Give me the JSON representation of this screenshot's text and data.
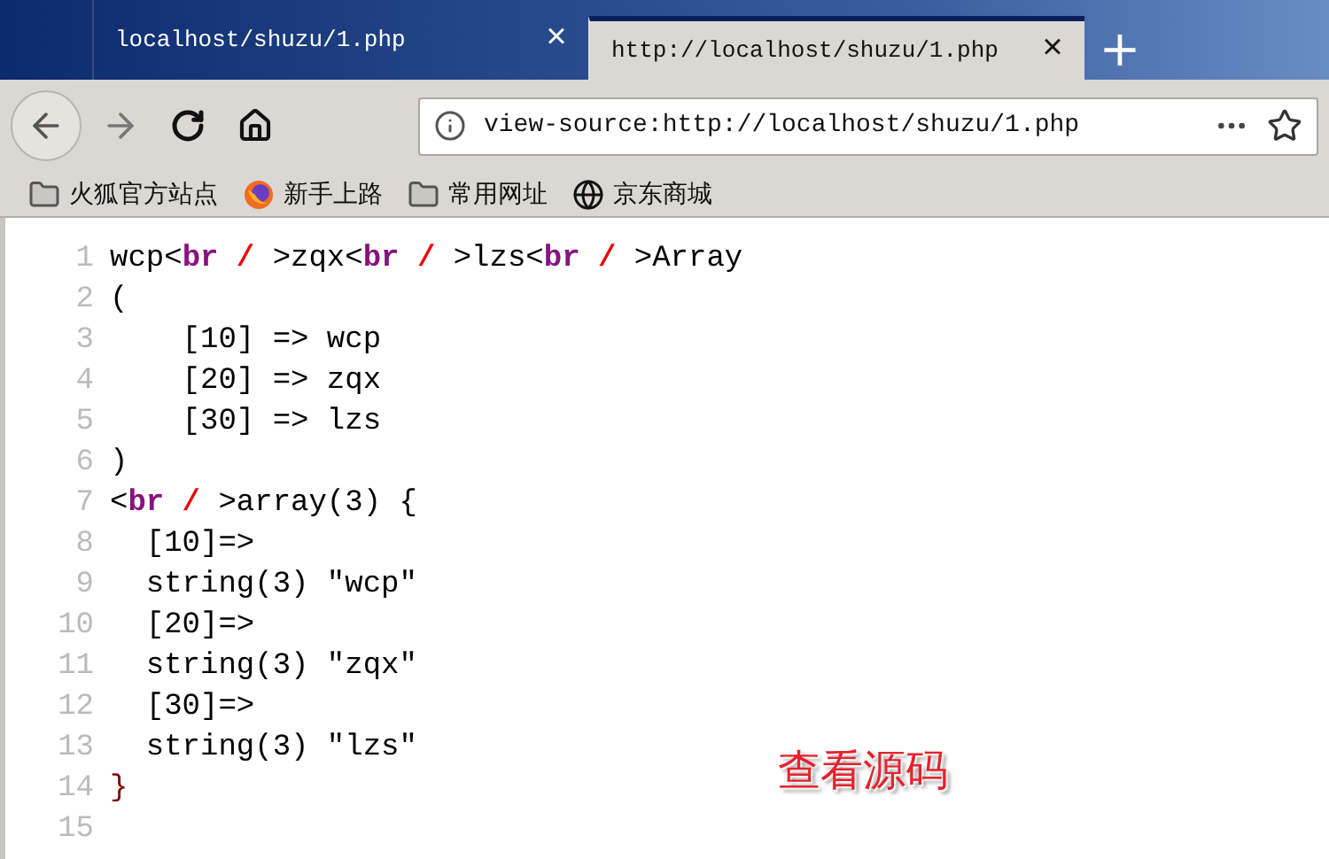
{
  "tabs": [
    {
      "title": "localhost/shuzu/1.php",
      "close": "×",
      "selected": false
    },
    {
      "title": "http://localhost/shuzu/1.php",
      "close": "×",
      "selected": true
    }
  ],
  "new_tab": "+",
  "address_bar": {
    "value": "view-source:http://localhost/shuzu/1.php"
  },
  "bookmarks": [
    {
      "label": "火狐官方站点",
      "kind": "folder"
    },
    {
      "label": "新手上路",
      "kind": "browser"
    },
    {
      "label": "常用网址",
      "kind": "folder"
    },
    {
      "label": "京东商城",
      "kind": "globe"
    }
  ],
  "source_lines": [
    {
      "number": "1",
      "segments": [
        {
          "kind": "text",
          "text": "wcp<"
        },
        {
          "kind": "tag",
          "text": "br"
        },
        {
          "kind": "slash",
          "text": " / "
        },
        {
          "kind": "text",
          "text": ">zqx<"
        },
        {
          "kind": "tag",
          "text": "br"
        },
        {
          "kind": "slash",
          "text": " / "
        },
        {
          "kind": "text",
          "text": ">lzs<"
        },
        {
          "kind": "tag",
          "text": "br"
        },
        {
          "kind": "slash",
          "text": " / "
        },
        {
          "kind": "text",
          "text": ">Array"
        }
      ]
    },
    {
      "number": "2",
      "segments": [
        {
          "kind": "text",
          "text": "("
        }
      ]
    },
    {
      "number": "3",
      "segments": [
        {
          "kind": "text",
          "text": "    [10] => wcp"
        }
      ]
    },
    {
      "number": "4",
      "segments": [
        {
          "kind": "text",
          "text": "    [20] => zqx"
        }
      ]
    },
    {
      "number": "5",
      "segments": [
        {
          "kind": "text",
          "text": "    [30] => lzs"
        }
      ]
    },
    {
      "number": "6",
      "segments": [
        {
          "kind": "text",
          "text": ")"
        }
      ]
    },
    {
      "number": "7",
      "segments": [
        {
          "kind": "text",
          "text": "<"
        },
        {
          "kind": "tag",
          "text": "br"
        },
        {
          "kind": "slash",
          "text": " / "
        },
        {
          "kind": "text",
          "text": ">array(3) {"
        }
      ]
    },
    {
      "number": "8",
      "segments": [
        {
          "kind": "text",
          "text": "  [10]=>"
        }
      ]
    },
    {
      "number": "9",
      "segments": [
        {
          "kind": "text",
          "text": "  string(3) \"wcp\""
        }
      ]
    },
    {
      "number": "10",
      "segments": [
        {
          "kind": "text",
          "text": "  [20]=>"
        }
      ]
    },
    {
      "number": "11",
      "segments": [
        {
          "kind": "text",
          "text": "  string(3) \"zqx\""
        }
      ]
    },
    {
      "number": "12",
      "segments": [
        {
          "kind": "text",
          "text": "  [30]=>"
        }
      ]
    },
    {
      "number": "13",
      "segments": [
        {
          "kind": "text",
          "text": "  string(3) \"lzs\""
        }
      ]
    },
    {
      "number": "14",
      "segments": [
        {
          "kind": "brace",
          "text": "}"
        }
      ]
    },
    {
      "number": "15"
    }
  ],
  "annotation": "查看源码"
}
